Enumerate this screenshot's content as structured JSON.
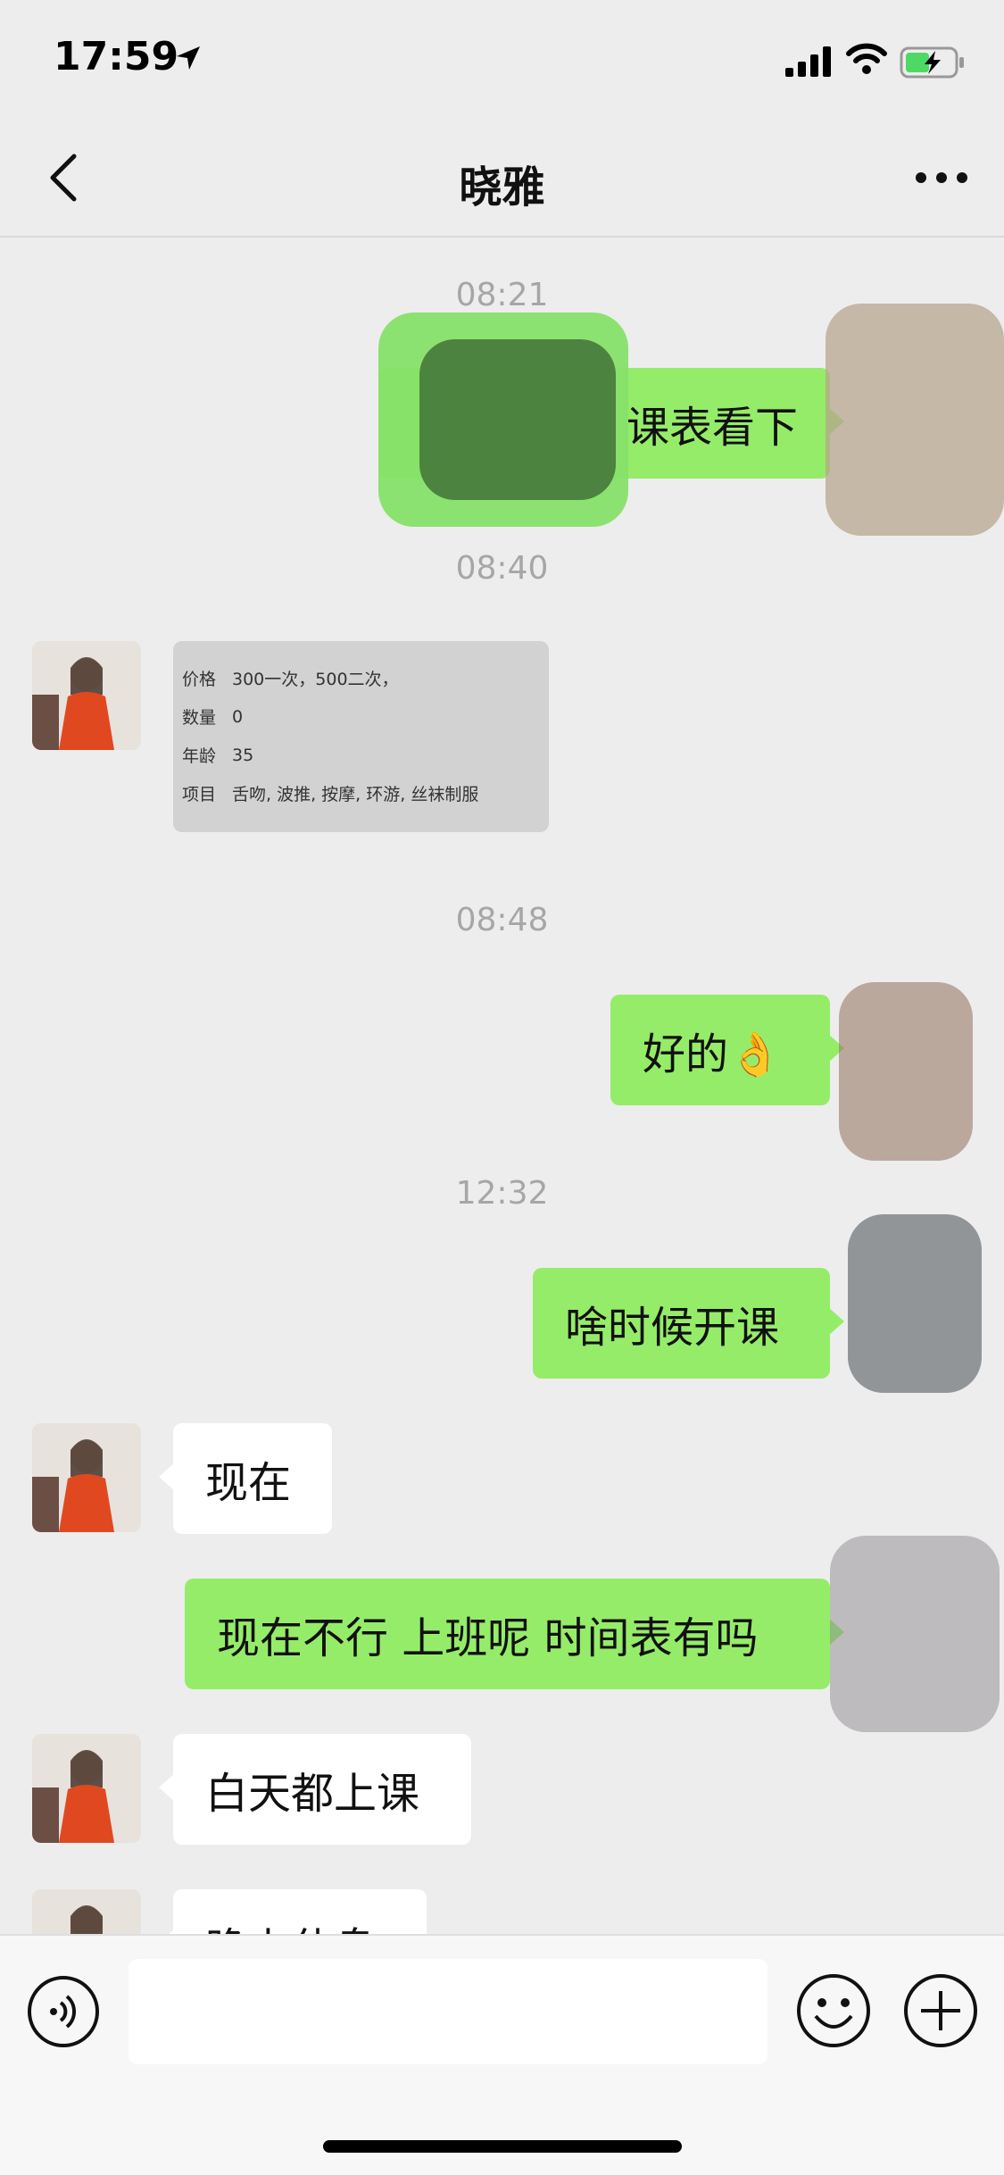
{
  "status_bar": {
    "time": "17:59",
    "battery_color": "#4cd964"
  },
  "nav": {
    "title": "晓雅",
    "back_icon": "chevron-left-icon",
    "more_icon": "more-dots-icon"
  },
  "messages": {
    "ts1": "08:21",
    "m1": "课表看下",
    "ts2": "08:40",
    "card": {
      "price_label": "价格",
      "price_value": "300一次，500二次，",
      "qty_label": "数量",
      "qty_value": "0",
      "age_label": "年龄",
      "age_value": "35",
      "item_label": "项目",
      "item_value": "舌吻, 波推, 按摩, 环游, 丝袜制服"
    },
    "ts3": "08:48",
    "m2": "好的👌",
    "ts4": "12:32",
    "m3": "啥时候开课",
    "m4": "现在",
    "m5": "现在不行 上班呢 时间表有吗",
    "m6": "白天都上课",
    "m7": "晚上休息"
  },
  "colors": {
    "outgoing_bubble": "#95ec69",
    "incoming_bubble": "#ffffff",
    "background": "#ededed"
  }
}
